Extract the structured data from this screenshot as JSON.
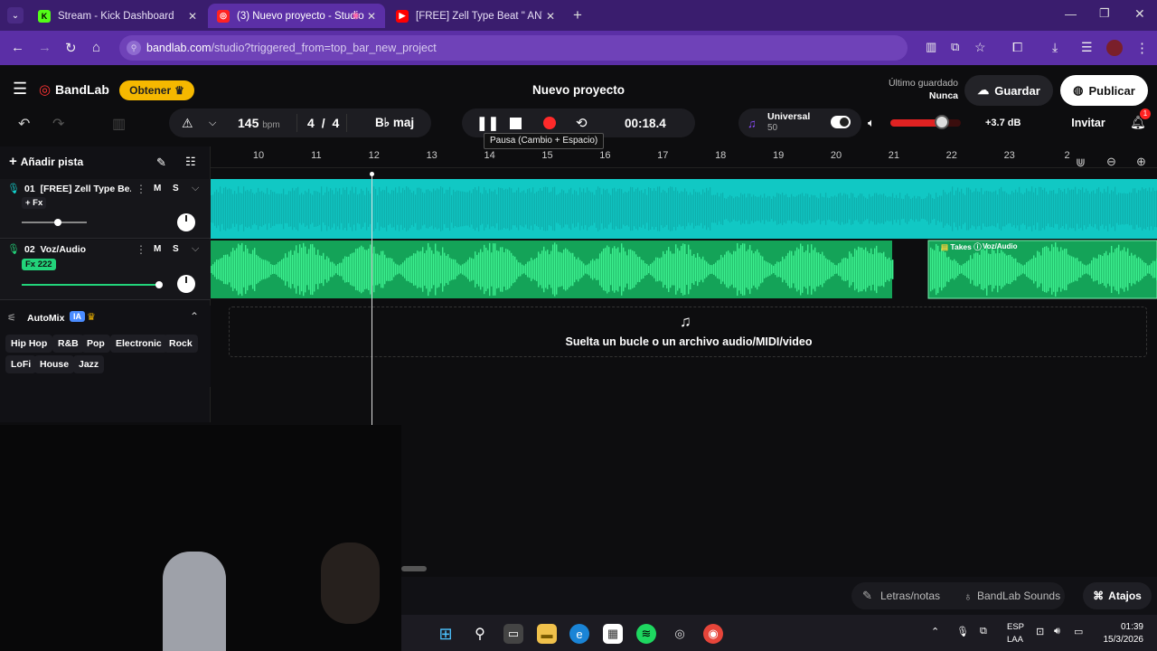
{
  "browser": {
    "tabs": [
      {
        "label": "Stream - Kick Dashboard"
      },
      {
        "label": "(3) Nuevo proyecto - Studio"
      },
      {
        "label": "[FREE] Zell Type Beat \" ANTES D"
      }
    ],
    "url_host": "bandlab.com",
    "url_path": "/studio?triggered_from=top_bar_new_project"
  },
  "app": {
    "logo": "BandLab",
    "obtener": "Obtener",
    "project_title": "Nuevo proyecto",
    "last_saved_label": "Último guardado",
    "last_saved_value": "Nunca",
    "save_label": "Guardar",
    "publish_label": "Publicar",
    "invite_label": "Invitar",
    "notifications_count": "1"
  },
  "transport": {
    "bpm": "145",
    "bpm_unit": "bpm",
    "time_sig_num": "4",
    "time_sig_sep": "/",
    "time_sig_den": "4",
    "key": "B♭ maj",
    "time": "00:18.4",
    "tooltip": "Pausa (Cambio + Espacio)",
    "preset_name": "Universal",
    "preset_value": "50",
    "volume_db": "+3.7 dB",
    "master_volume_level": 0.75
  },
  "timeline": {
    "ticks": [
      "10",
      "11",
      "12",
      "13",
      "14",
      "15",
      "16",
      "17",
      "18",
      "19",
      "20",
      "21",
      "22",
      "23",
      "2"
    ]
  },
  "tracks": [
    {
      "name": "01  [FREE] Zell Type Be...",
      "fx": "+ Fx",
      "m": "M",
      "s": "S",
      "volume_level": 0.55,
      "color": "#12d3cf"
    },
    {
      "name": "02  Voz/Audio",
      "fx": "Fx 222",
      "m": "M",
      "s": "S",
      "volume_level": 1.0,
      "color": "#22d47a"
    }
  ],
  "clip_labels": {
    "takes": "Takes",
    "clip_name": "Voz/Audio"
  },
  "left": {
    "add_track": "Añadir pista",
    "automix": "AutoMix",
    "automix_badge": "IA",
    "genres": [
      "Hip Hop",
      "R&B",
      "Pop",
      "Electronic",
      "Rock",
      "LoFi",
      "House",
      "Jazz"
    ]
  },
  "dropzone": "Suelta un bucle o un archivo audio/MIDI/video",
  "bottom": {
    "lyrics": "Letras/notas",
    "sounds": "BandLab Sounds",
    "shortcuts": "Atajos"
  },
  "taskbar": {
    "lang1": "ESP",
    "lang2": "LAA",
    "time": "01:39",
    "date": "15/3/2026"
  },
  "colors": {
    "accent": "#5b2fa6",
    "record": "#ff2a2a",
    "track1": "#12d3cf",
    "track2": "#22d47a",
    "obtener": "#f5b800"
  }
}
